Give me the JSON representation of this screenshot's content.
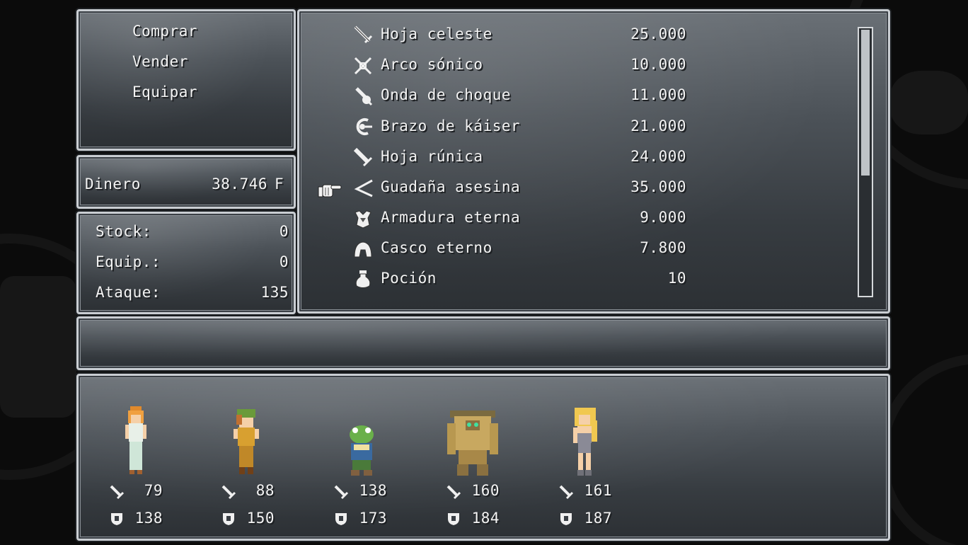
{
  "shop_menu": {
    "items": [
      "Comprar",
      "Vender",
      "Equipar"
    ]
  },
  "money": {
    "label": "Dinero",
    "value": "38.746",
    "unit": "F"
  },
  "stats": {
    "stock_label": "Stock:",
    "stock_value": "0",
    "equip_label": "Equip.:",
    "equip_value": "0",
    "attack_label": "Ataque:",
    "attack_value": "135"
  },
  "items": [
    {
      "icon": "sword-icon",
      "name": "Hoja celeste",
      "price": "25.000"
    },
    {
      "icon": "crossbow-icon",
      "name": "Arco sónico",
      "price": "10.000"
    },
    {
      "icon": "gun-icon",
      "name": "Onda de choque",
      "price": "11.000"
    },
    {
      "icon": "arm-cannon-icon",
      "name": "Brazo de káiser",
      "price": "21.000"
    },
    {
      "icon": "sword-icon",
      "name": "Hoja rúnica",
      "price": "24.000"
    },
    {
      "icon": "scythe-icon",
      "name": "Guadaña asesina",
      "price": "35.000"
    },
    {
      "icon": "armor-icon",
      "name": "Armadura eterna",
      "price": "9.000"
    },
    {
      "icon": "helmet-icon",
      "name": "Casco eterno",
      "price": "7.800"
    },
    {
      "icon": "potion-icon",
      "name": "Poción",
      "price": "10"
    }
  ],
  "selected_index": 5,
  "description": "",
  "party": [
    {
      "name": "marle",
      "attack": "79",
      "defense": "138"
    },
    {
      "name": "lucca",
      "attack": "88",
      "defense": "150"
    },
    {
      "name": "frog",
      "attack": "138",
      "defense": "173"
    },
    {
      "name": "robo",
      "attack": "160",
      "defense": "184"
    },
    {
      "name": "ayla",
      "attack": "161",
      "defense": "187"
    }
  ],
  "colors": {
    "text": "#f4f4f4",
    "panel_border": "#c9cdd2",
    "panel_top": "#6a7076",
    "panel_bottom": "#2c3034"
  }
}
